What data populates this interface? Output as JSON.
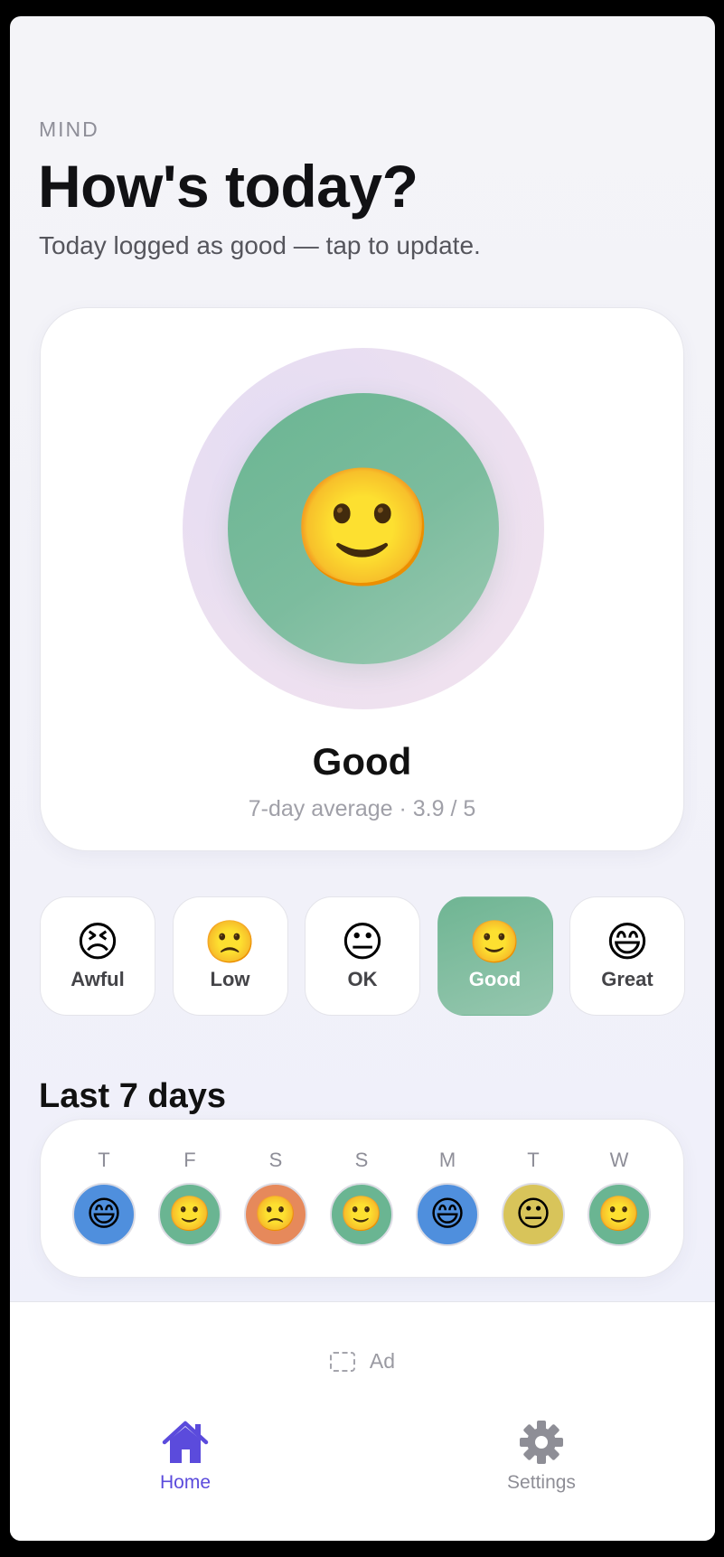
{
  "header": {
    "eyebrow": "MIND",
    "title": "How's today?",
    "subtitle": "Today logged as good — tap to update."
  },
  "hero": {
    "emoji": "🙂",
    "label": "Good",
    "average": "7-day average · 3.9 / 5",
    "core_color": "#6ab592"
  },
  "moods": [
    {
      "emoji": "😣",
      "label": "Awful",
      "selected": false
    },
    {
      "emoji": "🙁",
      "label": "Low",
      "selected": false
    },
    {
      "emoji": "😐",
      "label": "OK",
      "selected": false
    },
    {
      "emoji": "🙂",
      "label": "Good",
      "selected": true
    },
    {
      "emoji": "😄",
      "label": "Great",
      "selected": false
    }
  ],
  "history": {
    "title": "Last 7 days",
    "days": [
      {
        "label": "T",
        "emoji": "😄",
        "color": "#4f8fdd"
      },
      {
        "label": "F",
        "emoji": "🙂",
        "color": "#6ab592"
      },
      {
        "label": "S",
        "emoji": "🙁",
        "color": "#e6895b"
      },
      {
        "label": "S",
        "emoji": "🙂",
        "color": "#6ab592"
      },
      {
        "label": "M",
        "emoji": "😄",
        "color": "#4f8fdd"
      },
      {
        "label": "T",
        "emoji": "😐",
        "color": "#d8c45a"
      },
      {
        "label": "W",
        "emoji": "🙂",
        "color": "#6ab592"
      }
    ]
  },
  "ad": {
    "label": "Ad",
    "icon": "ad-placeholder-icon"
  },
  "tabbar": {
    "home": {
      "label": "Home",
      "icon": "home-icon",
      "active": true,
      "color": "#5b4bdc"
    },
    "settings": {
      "label": "Settings",
      "icon": "gear-icon",
      "active": false,
      "color": "#8e8e96"
    }
  }
}
